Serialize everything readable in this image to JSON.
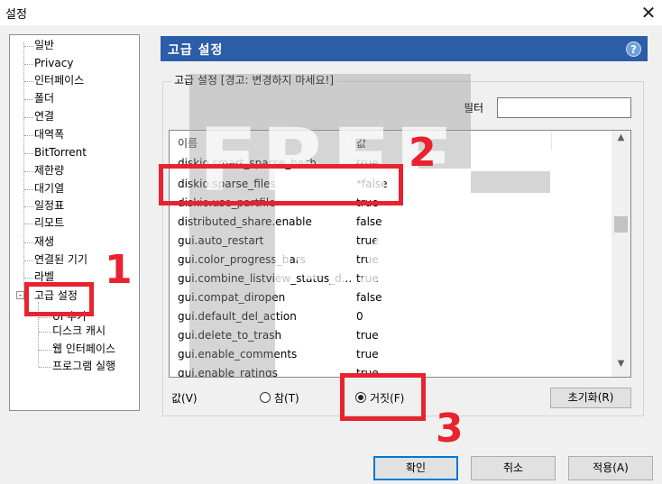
{
  "window": {
    "title": "설정",
    "close_icon": "close-icon"
  },
  "tree": {
    "items": [
      {
        "label": "일반"
      },
      {
        "label": "Privacy"
      },
      {
        "label": "인터페이스"
      },
      {
        "label": "폴더"
      },
      {
        "label": "연결"
      },
      {
        "label": "대역폭"
      },
      {
        "label": "BitTorrent"
      },
      {
        "label": "제한량"
      },
      {
        "label": "대기열"
      },
      {
        "label": "일정표"
      },
      {
        "label": "리모트"
      },
      {
        "label": "재생"
      },
      {
        "label": "연결된 기기"
      },
      {
        "label": "라벨"
      },
      {
        "label": "고급 설정",
        "selected": true
      },
      {
        "label": "UI 추가"
      },
      {
        "label": "디스크 캐시"
      },
      {
        "label": "웹 인터페이스"
      },
      {
        "label": "프로그램 실행"
      }
    ],
    "expand_glyph": "-"
  },
  "header": {
    "title": "고급 설정",
    "help": "?"
  },
  "group": {
    "label": "고급 설정 [경고: 변경하지 마세요!]"
  },
  "filter": {
    "label": "필터",
    "value": ""
  },
  "list": {
    "columns": [
      "이름",
      "값"
    ],
    "rows": [
      {
        "name": "diskio.smart_sparse_hash",
        "value": "true"
      },
      {
        "name": "diskio.sparse_files",
        "value": "*false"
      },
      {
        "name": "diskio.use_partfile",
        "value": "true"
      },
      {
        "name": "distributed_share.enable",
        "value": "false"
      },
      {
        "name": "gui.auto_restart",
        "value": "true"
      },
      {
        "name": "gui.color_progress_bars",
        "value": "true"
      },
      {
        "name": "gui.combine_listview_status_d...",
        "value": "true"
      },
      {
        "name": "gui.compat_diropen",
        "value": "false"
      },
      {
        "name": "gui.default_del_action",
        "value": "0"
      },
      {
        "name": "gui.delete_to_trash",
        "value": "true"
      },
      {
        "name": "gui.enable_comments",
        "value": "true"
      },
      {
        "name": "gui.enable_ratings",
        "value": "true"
      }
    ]
  },
  "value_row": {
    "label": "값(V)",
    "true_label": "참(T)",
    "false_label": "거짓(F)",
    "selected": "false",
    "reset_label": "초기화(R)"
  },
  "buttons": {
    "ok": "확인",
    "cancel": "취소",
    "apply": "적용(A)"
  },
  "watermark": {
    "line1": "FREE",
    "line2": "MAN"
  },
  "annotations": {
    "n1": "1",
    "n2": "2",
    "n3": "3",
    "color": "#e8232f"
  },
  "colors": {
    "header": "#2b5da8",
    "accent_focus": "#0078d7"
  }
}
